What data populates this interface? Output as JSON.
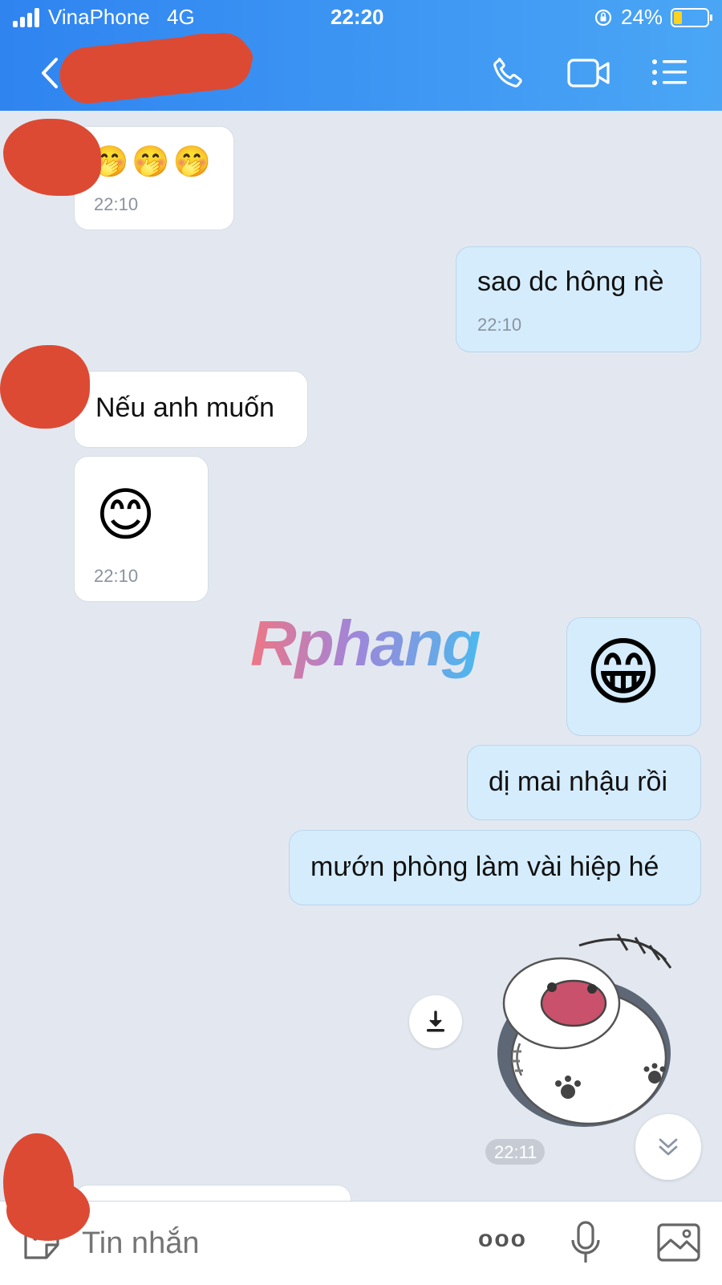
{
  "status_bar": {
    "carrier": "VinaPhone",
    "network": "4G",
    "time": "22:20",
    "battery": "24%",
    "battery_level": 0.24
  },
  "header": {
    "icons": [
      "back-arrow-icon",
      "phone-icon",
      "video-camera-icon",
      "menu-list-icon"
    ]
  },
  "messages": {
    "m1": {
      "emoji": "🤭🤭🤭",
      "time": "22:10"
    },
    "m2": {
      "text": "sao dc hông nè",
      "time": "22:10"
    },
    "m3": {
      "text": "Nếu anh muốn"
    },
    "m4": {
      "emoji": "😊",
      "time": "22:10"
    },
    "m5": {
      "emoji": "😁"
    },
    "m6": {
      "text": "dị mai nhậu rồi"
    },
    "m7": {
      "text": "mướn phòng làm vài hiệp hé"
    },
    "m8": {
      "sticker": "cat sticker",
      "time": "22:11"
    }
  },
  "watermark": "Rphang",
  "input_bar": {
    "placeholder": "Tin nhắn",
    "more_label": "ooo"
  },
  "colors": {
    "header_start": "#2f84f0",
    "header_end": "#4aa6f5",
    "chat_bg": "#e3e8f0",
    "outgoing_bubble": "#d5ecfc",
    "incoming_bubble": "#ffffff",
    "redaction": "#dc4a34"
  }
}
